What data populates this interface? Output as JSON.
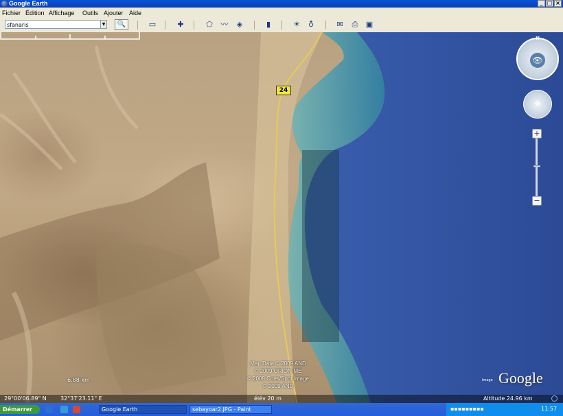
{
  "window": {
    "title": "Google Earth",
    "controls": [
      "_",
      "□",
      "×"
    ]
  },
  "menu": {
    "items": [
      "Fichier",
      "Édition",
      "Affichage",
      "Outils",
      "Ajouter",
      "Aide"
    ]
  },
  "toolbar": {
    "search_value": "sfanaris",
    "icons": [
      "search-go-icon",
      "sidebar-toggle-icon",
      "placemark-icon",
      "polygon-icon",
      "path-icon",
      "overlay-icon",
      "ruler-icon",
      "sun-icon",
      "planet-icon",
      "email-icon",
      "print-icon",
      "view-in-maps-icon"
    ]
  },
  "map": {
    "road_shield": "24",
    "attribution": [
      "Map Data © 2009 AND",
      "© 2009 ORION-ME",
      "© 2009 Cnes/Spot Image",
      "© 2009 AND"
    ],
    "scale_label": "6.88 km",
    "compass_letter": "N",
    "google_prefix": "Image",
    "google_logo": "Google"
  },
  "status": {
    "latitude": "29°00'06.89\" N",
    "longitude": "32°37'23.11\" E",
    "elevation": "élév    20 m",
    "altitude": "Altitude   24.96 km"
  },
  "taskbar": {
    "start": "Démarrer",
    "tasks": [
      "Google Earth",
      "sebayoar2.JPG - Paint"
    ],
    "clock": "11:57"
  },
  "colors": {
    "sea": "#2f4f9c",
    "shallow_water": "#2a8aa8",
    "desert": "#b9a07f",
    "road": "#e6c75a"
  }
}
